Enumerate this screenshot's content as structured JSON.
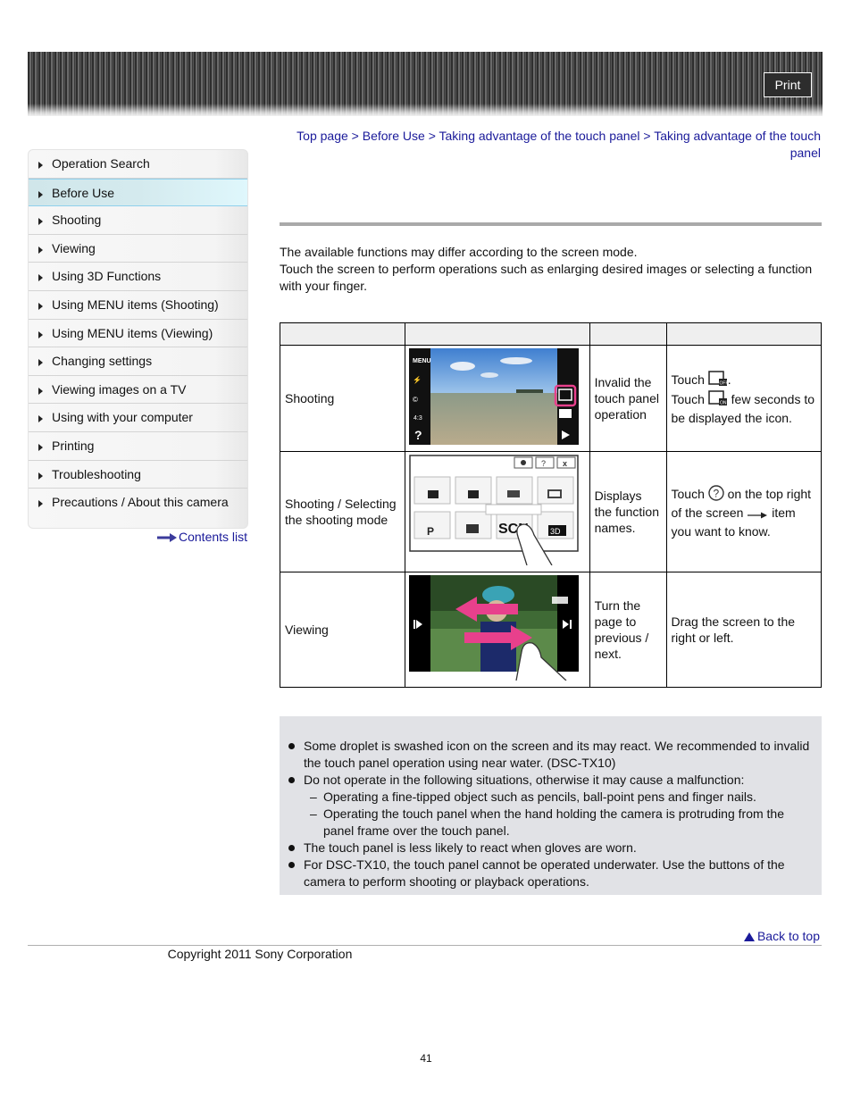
{
  "header": {
    "print_label": "Print"
  },
  "sidebar": {
    "items": [
      {
        "label": "Operation Search",
        "active": false
      },
      {
        "label": "Before Use",
        "active": true
      },
      {
        "label": "Shooting",
        "active": false
      },
      {
        "label": "Viewing",
        "active": false
      },
      {
        "label": "Using 3D Functions",
        "active": false
      },
      {
        "label": "Using MENU items (Shooting)",
        "active": false
      },
      {
        "label": "Using MENU items (Viewing)",
        "active": false
      },
      {
        "label": "Changing settings",
        "active": false
      },
      {
        "label": "Viewing images on a TV",
        "active": false
      },
      {
        "label": "Using with your computer",
        "active": false
      },
      {
        "label": "Printing",
        "active": false
      },
      {
        "label": "Troubleshooting",
        "active": false
      },
      {
        "label": "Precautions / About this camera",
        "active": false
      }
    ],
    "contents_list_label": "Contents list"
  },
  "breadcrumb": {
    "items": [
      "Top page",
      "Before Use",
      "Taking advantage of the touch panel",
      "Taking advantage of the touch panel"
    ],
    "separator": ">"
  },
  "intro": {
    "line1": "The available functions may differ according to the screen mode.",
    "line2": "Touch the screen to perform operations such as enlarging desired images or selecting a function with your finger."
  },
  "table": {
    "headers": [
      "",
      "",
      "",
      ""
    ],
    "rows": [
      {
        "mode": "Shooting",
        "image": "shooting-screen-touch-panel-off",
        "function": "Invalid the touch panel operation",
        "how_parts": {
          "a": "Touch",
          "b": ".",
          "c": "Touch",
          "d": "few seconds to be displayed the icon."
        },
        "icons": [
          "touch-panel-off-icon",
          "touch-panel-on-icon"
        ]
      },
      {
        "mode": "Shooting / Selecting the shooting mode",
        "image": "shooting-mode-selection-screen",
        "function": "Displays the function names.",
        "how_parts": {
          "a": "Touch",
          "b": "on the top right of the screen",
          "c": "item you want to know."
        },
        "icons": [
          "help-icon",
          "arrow-right-icon"
        ],
        "screen_labels": [
          "SCN",
          "P",
          "3D"
        ]
      },
      {
        "mode": "Viewing",
        "image": "viewing-screen-swipe",
        "function": "Turn the page to previous / next.",
        "how": "Drag the screen to the right or left."
      }
    ]
  },
  "notes": {
    "items": [
      {
        "type": "bullet",
        "text": "Some droplet is swashed icon on the screen and its may react. We recommended to invalid the touch panel operation using near water. (DSC-TX10)"
      },
      {
        "type": "bullet",
        "text": "Do not operate in the following situations, otherwise it may cause a malfunction:"
      },
      {
        "type": "dash",
        "text": "Operating a fine-tipped object such as pencils, ball-point pens and finger nails."
      },
      {
        "type": "dash",
        "text": "Operating the touch panel when the hand holding the camera is protruding from the panel frame over the touch panel."
      },
      {
        "type": "bullet",
        "text": "The touch panel is less likely to react when gloves are worn."
      },
      {
        "type": "bullet",
        "text": "For DSC-TX10, the touch panel cannot be operated underwater. Use the buttons of the camera to perform shooting or playback operations."
      }
    ]
  },
  "footer": {
    "back_to_top": "Back to top",
    "copyright": "Copyright 2011 Sony Corporation",
    "page_number": "41"
  },
  "colors": {
    "link": "#1a1a9a",
    "active_nav": "#d4eaee",
    "notes_bg": "#e1e2e6",
    "highlight_pink": "#e8408c"
  }
}
